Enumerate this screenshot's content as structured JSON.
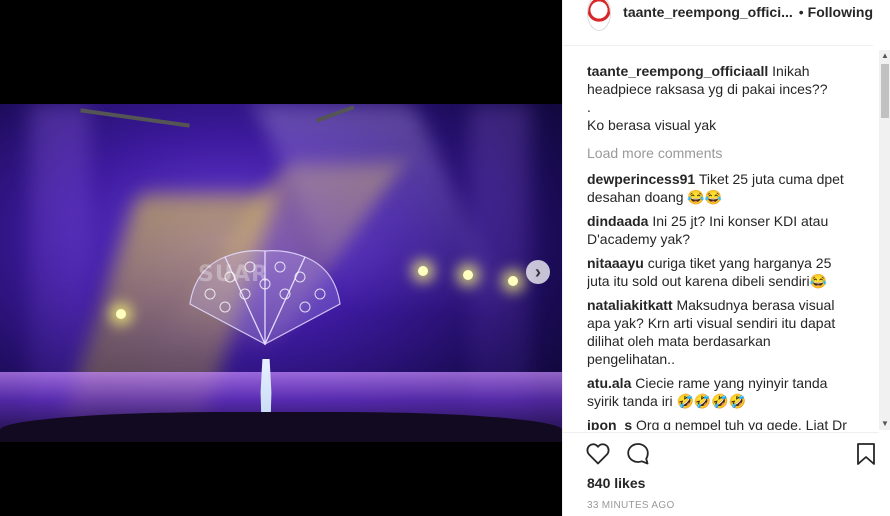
{
  "media": {
    "watermark": "SUAR",
    "next_icon": "chevron-right-icon",
    "next_glyph": "›"
  },
  "header": {
    "username": "taante_reempong_offici...",
    "separator": "•",
    "follow_label": "Following"
  },
  "caption": {
    "username": "taante_reempong_officiaall",
    "text_line1": "Inikah headpiece raksasa yg di pakai inces??",
    "text_line2": ".",
    "text_line3": "Ko berasa visual yak"
  },
  "load_more": "Load more comments",
  "comments": [
    {
      "username": "dewperincess91",
      "text": "Tiket 25 juta cuma dpet desahan doang 😂😂"
    },
    {
      "username": "dindaada",
      "text": "Ini 25 jt? Ini konser KDI atau D'academy yak?"
    },
    {
      "username": "nitaaayu",
      "text": "curiga tiket yang harganya 25 juta itu sold out karena dibeli sendiri😂"
    },
    {
      "username": "nataliakitkatt",
      "text": "Maksudnya berasa visual apa yak? Krn arti visual sendiri itu dapat dilihat oleh mata berdasarkan pengelihatan.."
    },
    {
      "username": "atu.ala",
      "text": "Ciecie rame yang nyinyir tanda syirik tanda iri 🤣🤣🤣🤣"
    },
    {
      "username": "ipon_s",
      "text": "Org g nempel tuh yg gede. Liat Dr snapgram bbrp ertong"
    }
  ],
  "actions": {
    "likes": "840 likes",
    "time": "33 MINUTES AGO"
  },
  "colors": {
    "text": "#262626",
    "muted": "#999999",
    "border": "#efefef",
    "brand_red": "#d62828"
  }
}
